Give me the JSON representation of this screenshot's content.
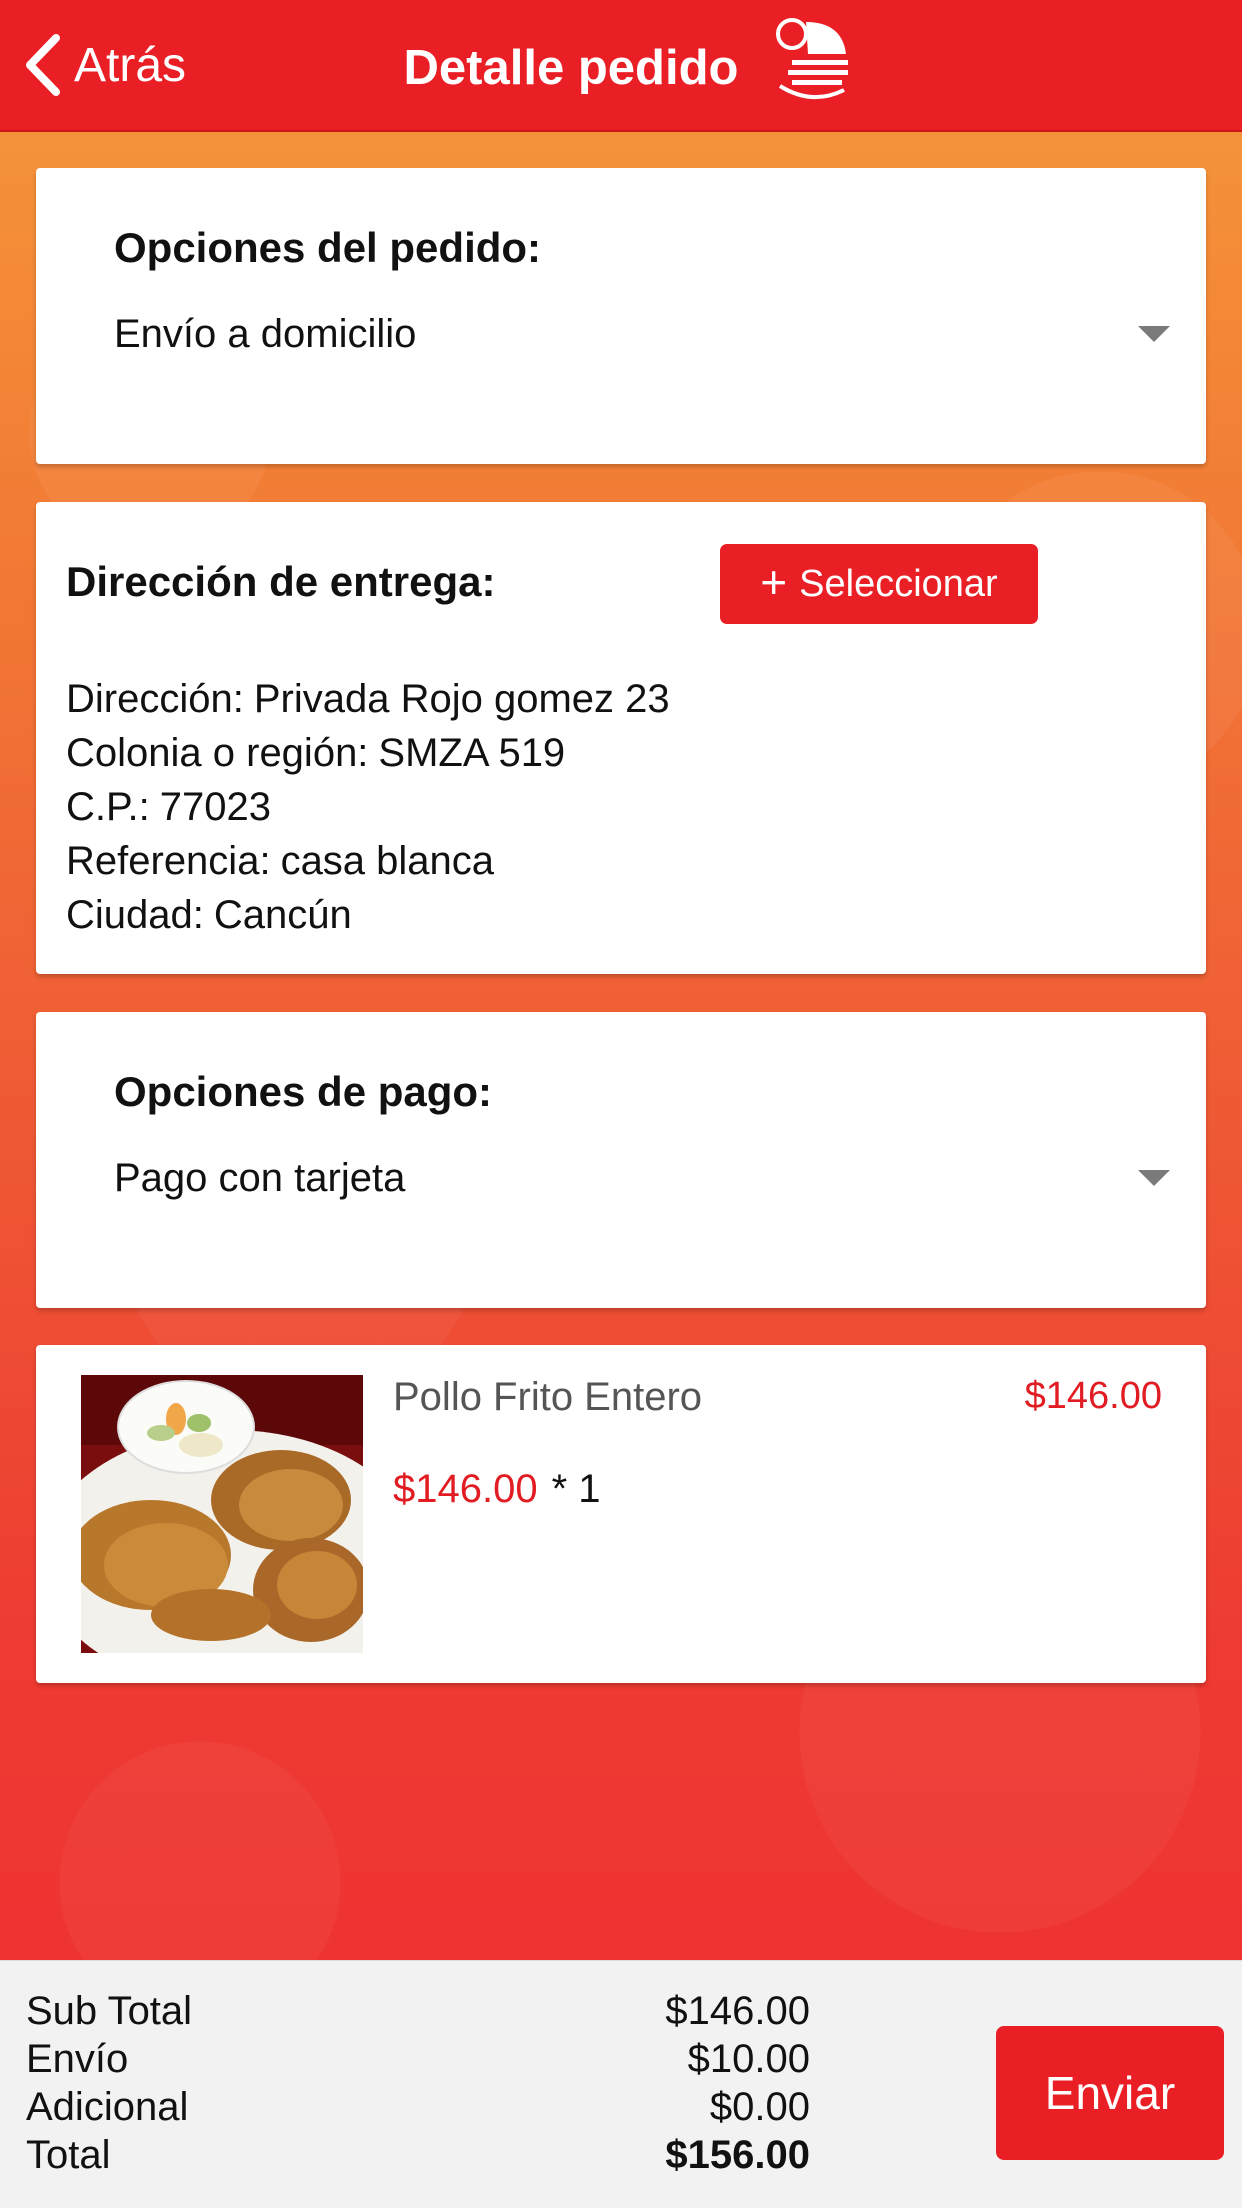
{
  "colors": {
    "accent": "#ea1f26",
    "price": "#e11c22",
    "footer_bg": "#f2f2f2"
  },
  "header": {
    "back_label": "Atrás",
    "title": "Detalle pedido",
    "back_icon": "chevron-left-icon",
    "logo_icon": "brand-logo-icon"
  },
  "order_options": {
    "heading": "Opciones del pedido:",
    "selected": "Envío a domicilio"
  },
  "delivery": {
    "heading": "Dirección de entrega:",
    "select_label": "Seleccionar",
    "lines": [
      {
        "label": "Dirección:",
        "value": "Privada Rojo gomez 23"
      },
      {
        "label": "Colonia o región:",
        "value": "SMZA 519"
      },
      {
        "label": "C.P.:",
        "value": "77023"
      },
      {
        "label": "Referencia:",
        "value": "casa blanca"
      },
      {
        "label": "Ciudad:",
        "value": "Cancún"
      }
    ]
  },
  "payment": {
    "heading": "Opciones de pago:",
    "selected": "Pago con tarjeta"
  },
  "items": [
    {
      "name": "Pollo Frito Entero",
      "total": "$146.00",
      "unit_price": "$146.00",
      "qty_text": "* 1"
    }
  ],
  "summary": {
    "rows": [
      {
        "label": "Sub Total",
        "value": "$146.00"
      },
      {
        "label": "Envío",
        "value": "$10.00"
      },
      {
        "label": "Adicional",
        "value": "$0.00"
      },
      {
        "label": "Total",
        "value": "$156.00"
      }
    ],
    "send_label": "Enviar"
  }
}
